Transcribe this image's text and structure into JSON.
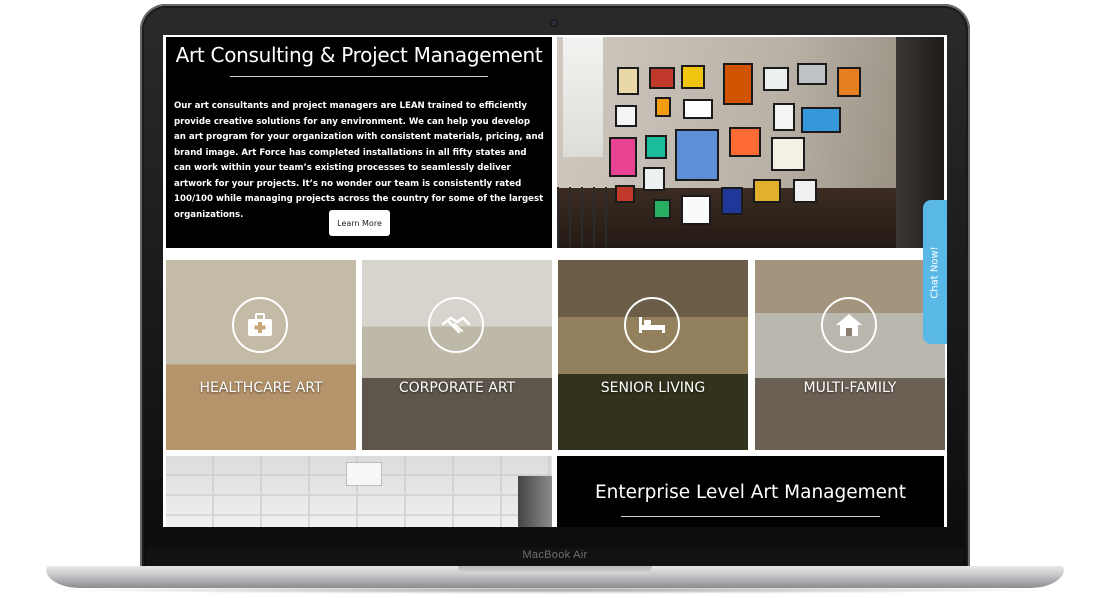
{
  "laptop": {
    "brand": "MacBook Air"
  },
  "consulting": {
    "title": "Art Consulting & Project Management",
    "body": "Our art consultants and project managers are LEAN trained to efficiently provide creative solutions for any environment. We can help you develop an art program for your organization with consistent materials, pricing, and brand image. Art Force has completed installations in all fifty states and can work within your team’s existing processes to seamlessly deliver artwork for your projects. It’s no wonder our team is consistently rated 100/100 while managing projects across the country for some of the largest organizations.",
    "button_label": "Learn More"
  },
  "categories": [
    {
      "label": "HEALTHCARE ART",
      "icon": "briefcase-medical-icon"
    },
    {
      "label": "CORPORATE ART",
      "icon": "handshake-icon"
    },
    {
      "label": "SENIOR LIVING",
      "icon": "bed-icon"
    },
    {
      "label": "MULTI-FAMILY",
      "icon": "house-icon"
    }
  ],
  "enterprise": {
    "title": "Enterprise Level Art Management"
  },
  "chat": {
    "label": "Chat Now!",
    "color": "#5ab8e6"
  }
}
